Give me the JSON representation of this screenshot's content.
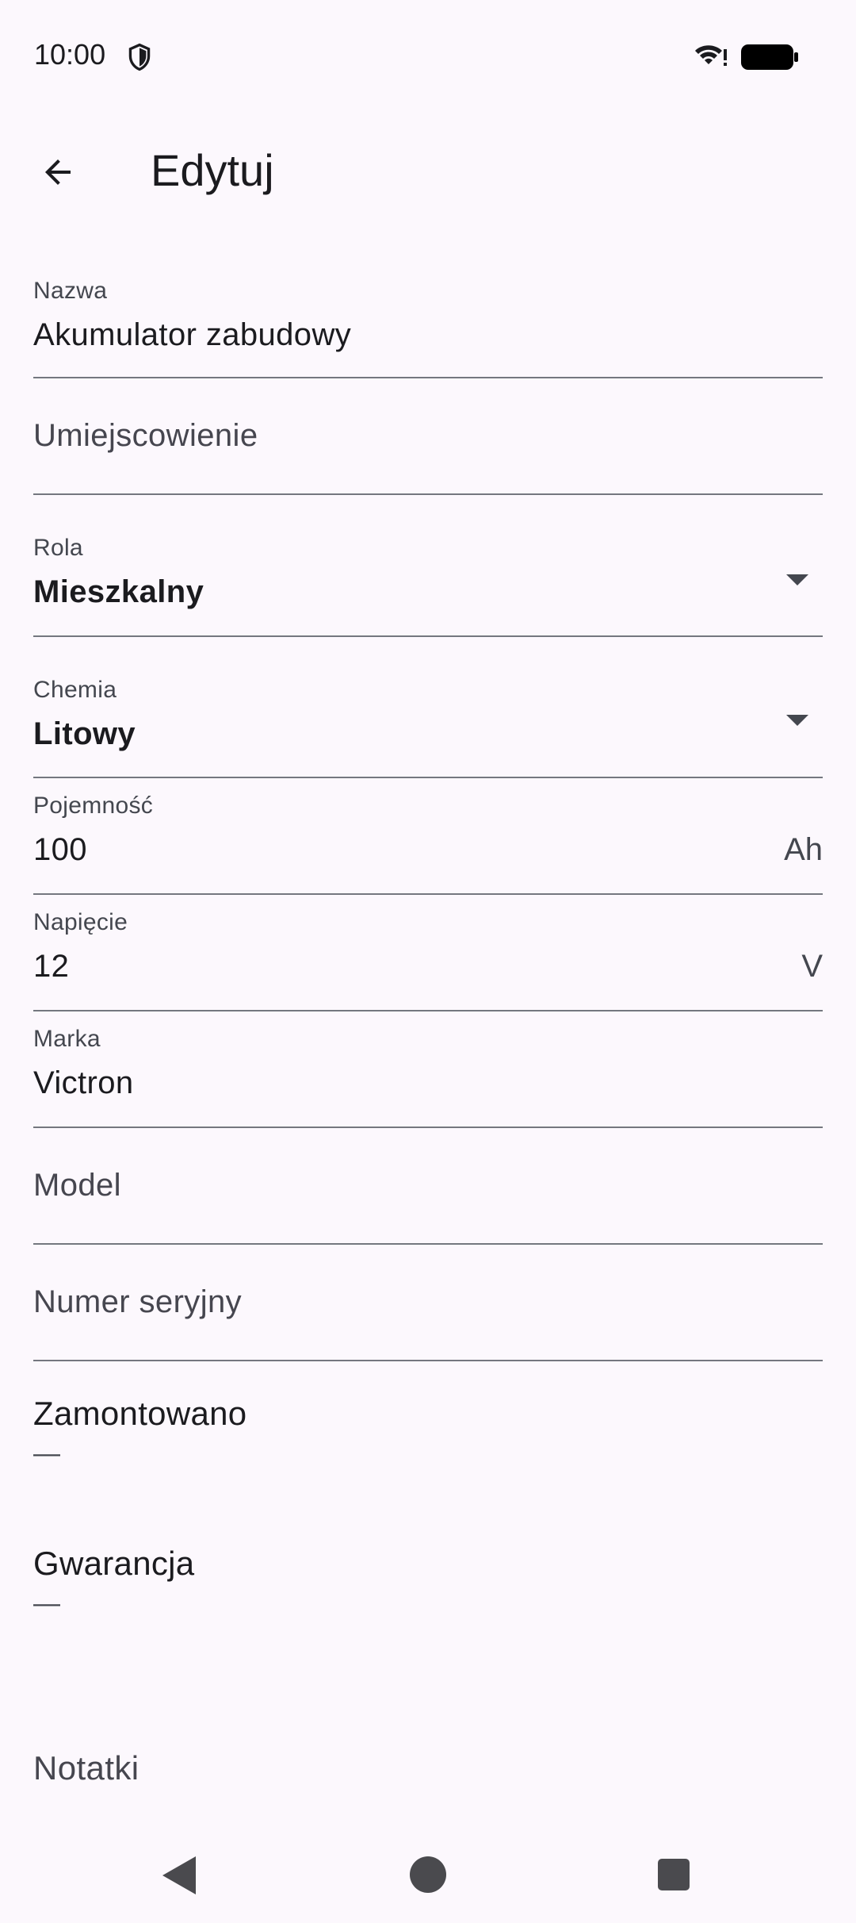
{
  "status_bar": {
    "time": "10:00",
    "icons": [
      "shield-icon",
      "wifi-icon",
      "battery-icon"
    ]
  },
  "top_bar": {
    "back_icon": "arrow-back-icon",
    "title": "Edytuj"
  },
  "form": {
    "name": {
      "label": "Nazwa",
      "value": "Akumulator zabudowy"
    },
    "location": {
      "placeholder": "Umiejscowienie"
    },
    "role": {
      "label": "Rola",
      "value": "Mieszkalny"
    },
    "chemistry": {
      "label": "Chemia",
      "value": "Litowy"
    },
    "capacity": {
      "label": "Pojemność",
      "value": "100",
      "suffix": "Ah"
    },
    "voltage": {
      "label": "Napięcie",
      "value": "12",
      "suffix": "V"
    },
    "brand": {
      "label": "Marka",
      "value": "Victron"
    },
    "model": {
      "placeholder": "Model"
    },
    "serial": {
      "placeholder": "Numer seryjny"
    },
    "installed": {
      "label": "Zamontowano",
      "value": "—"
    },
    "warranty": {
      "label": "Gwarancja",
      "value": "—"
    },
    "notes": {
      "placeholder": "Notatki"
    }
  },
  "nav_bar": {
    "icons": [
      "nav-back-icon",
      "nav-home-icon",
      "nav-recents-icon"
    ]
  },
  "colors": {
    "background": "#fcf8fd",
    "text": "#1b1b1f",
    "label": "#44474f",
    "divider": "#74777f"
  }
}
